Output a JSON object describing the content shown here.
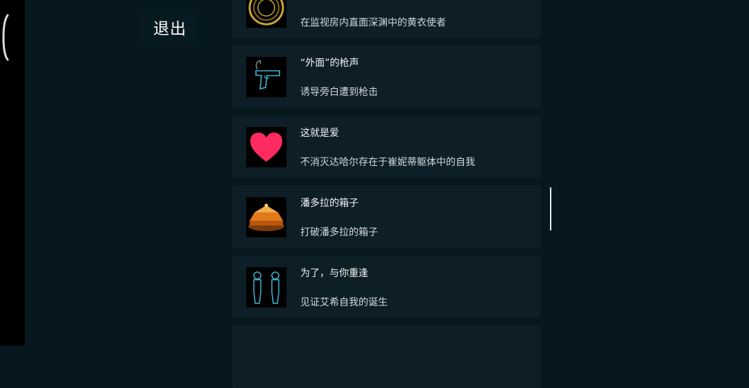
{
  "header": {
    "exit_label": "退出"
  },
  "achievements": [
    {
      "title": "",
      "desc": "在监视房内直面深渊中的黄衣使者",
      "icon": "golden-ring-icon"
    },
    {
      "title": "“外面”的枪声",
      "desc": "诱导旁白遭到枪击",
      "icon": "pistol-icon"
    },
    {
      "title": "这就是爱",
      "desc": "不消灭达哈尔存在于崔妮蒂躯体中的自我",
      "icon": "heart-icon"
    },
    {
      "title": "潘多拉的箱子",
      "desc": "打破潘多拉的箱子",
      "icon": "pandora-box-icon"
    },
    {
      "title": "为了，与你重逢",
      "desc": "见证艾希自我的诞生",
      "icon": "twin-figures-icon"
    }
  ],
  "colors": {
    "background": "#07171e",
    "card": "#0d1e26",
    "heart": "#ff2a5f",
    "ring": "#c9a531",
    "wire": "#3fb6d6",
    "box": "#e07a1c"
  }
}
